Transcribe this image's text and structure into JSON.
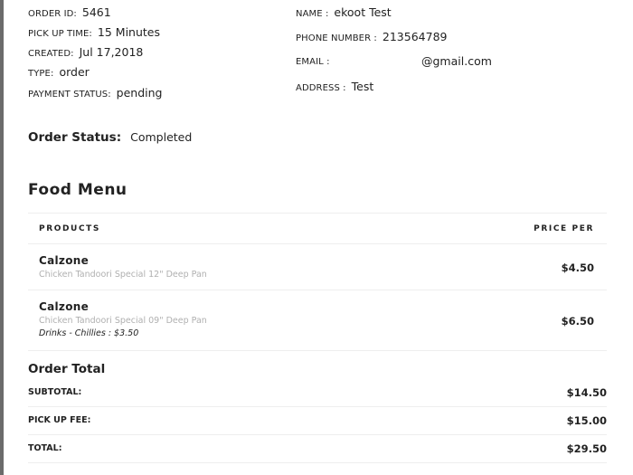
{
  "order_info": {
    "order_id": {
      "label": "ORDER ID:",
      "value": "5461"
    },
    "pickup_time": {
      "label": "PICK UP TIME:",
      "value": "15 Minutes"
    },
    "created": {
      "label": "CREATED:",
      "value": "Jul 17,2018"
    },
    "type": {
      "label": "TYPE:",
      "value": "order"
    },
    "payment_status": {
      "label": "PAYMENT STATUS:",
      "value": "pending"
    }
  },
  "customer": {
    "name": {
      "label": "NAME :",
      "value": "ekoot Test"
    },
    "phone": {
      "label": "PHONE NUMBER :",
      "value": "213564789"
    },
    "email": {
      "label": "EMAIL :",
      "value": "@gmail.com"
    },
    "address": {
      "label": "ADDRESS :",
      "value": "Test"
    }
  },
  "order_status": {
    "label": "Order Status:",
    "value": "Completed"
  },
  "food_menu": {
    "title": "Food Menu",
    "headers": {
      "products": "PRODUCTS",
      "price": "PRICE PER"
    },
    "items": [
      {
        "name": "Calzone",
        "description": "Chicken Tandoori Special 12\" Deep Pan",
        "extra": "",
        "price": "$4.50"
      },
      {
        "name": "Calzone",
        "description": "Chicken Tandoori Special 09\" Deep Pan",
        "extra": "Drinks - Chillies : $3.50",
        "price": "$6.50"
      }
    ]
  },
  "order_total": {
    "title": "Order Total",
    "subtotal": {
      "label": "SUBTOTAL:",
      "value": "$14.50"
    },
    "pickup_fee": {
      "label": "PICK UP FEE:",
      "value": "$15.00"
    },
    "total": {
      "label": "TOTAL:",
      "value": "$29.50"
    }
  },
  "colors": {
    "left_rule": "#6b6b6b",
    "muted_text": "#b0b0b0",
    "divider": "#eeeeee"
  }
}
